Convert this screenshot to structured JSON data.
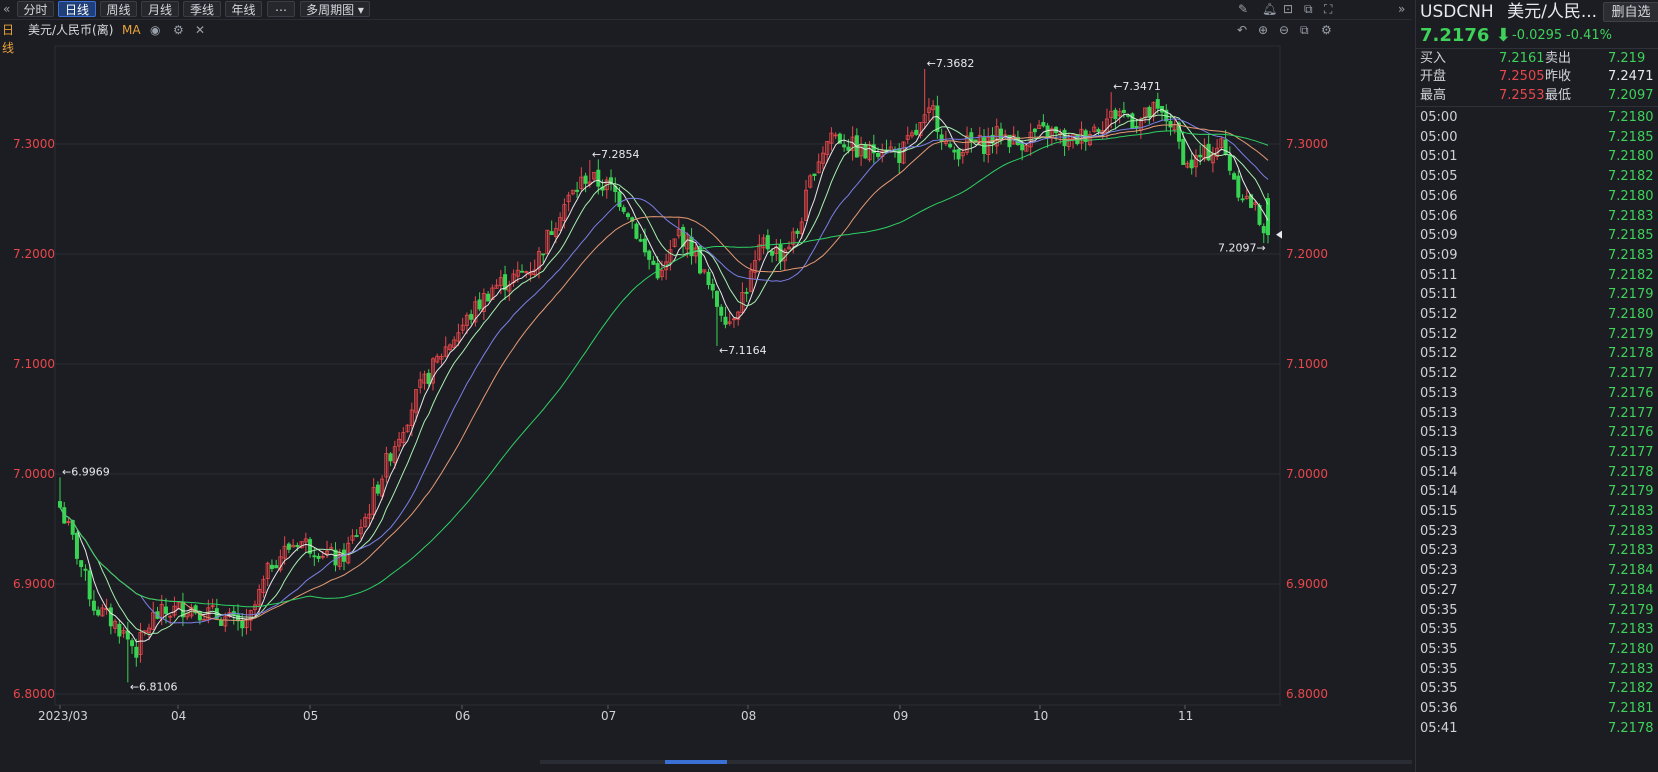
{
  "toolbar": {
    "back_icon": "double-chevron-left-icon",
    "tabs": [
      {
        "label": "分时",
        "active": false
      },
      {
        "label": "日线",
        "active": true
      },
      {
        "label": "周线",
        "active": false
      },
      {
        "label": "月线",
        "active": false
      },
      {
        "label": "季线",
        "active": false
      },
      {
        "label": "年线",
        "active": false
      },
      {
        "label": "⋯",
        "active": false
      },
      {
        "label": "多周期图 ▾",
        "active": false
      }
    ],
    "right_icons": [
      "pencil-icon",
      "bell-icon",
      "lock-icon",
      "camera-icon",
      "fullscreen-icon",
      "double-chevron-right-icon"
    ]
  },
  "legend": {
    "period": "日线",
    "instrument": "美元/人民币(离)",
    "indicator": "MA",
    "icons": [
      "eye-icon",
      "gear-icon",
      "close-icon"
    ],
    "right_icons": [
      "undo-icon",
      "zoom-in-icon",
      "zoom-out-icon",
      "compare-icon",
      "settings-icon"
    ]
  },
  "colors": {
    "up": "#e8474b",
    "down": "#39d353",
    "ma1": "#e9e9ea",
    "ma2": "#a8f0b0",
    "ma3": "#7b7fe6",
    "ma4": "#e59a74",
    "ma5": "#2ed163",
    "axis_label": "#e8474b",
    "grid": "#2b2d34"
  },
  "chart_data": {
    "type": "candlestick",
    "y_ticks": [
      "7.3000",
      "7.2000",
      "7.1000",
      "7.0000",
      "6.9000",
      "6.8000"
    ],
    "ylim": [
      6.8,
      7.38
    ],
    "x_ticks": [
      "2023/03",
      "04",
      "05",
      "06",
      "07",
      "08",
      "09",
      "10",
      "11"
    ],
    "annotations": [
      {
        "text": "←6.9969",
        "value": 6.9969
      },
      {
        "text": "←6.8106",
        "value": 6.8106
      },
      {
        "text": "←7.2854",
        "value": 7.2854
      },
      {
        "text": "←7.1164",
        "value": 7.1164
      },
      {
        "text": "←7.3682",
        "value": 7.3682
      },
      {
        "text": "←7.3471",
        "value": 7.3471
      },
      {
        "text": "7.2097→",
        "value": 7.2097
      }
    ],
    "close_anchors": [
      [
        0,
        6.97
      ],
      [
        3,
        6.94
      ],
      [
        8,
        6.88
      ],
      [
        14,
        6.86
      ],
      [
        18,
        6.84
      ],
      [
        22,
        6.87
      ],
      [
        30,
        6.88
      ],
      [
        38,
        6.87
      ],
      [
        44,
        6.86
      ],
      [
        50,
        6.92
      ],
      [
        56,
        6.94
      ],
      [
        62,
        6.93
      ],
      [
        66,
        6.92
      ],
      [
        72,
        6.96
      ],
      [
        78,
        7.02
      ],
      [
        84,
        7.07
      ],
      [
        90,
        7.11
      ],
      [
        96,
        7.14
      ],
      [
        102,
        7.17
      ],
      [
        108,
        7.18
      ],
      [
        112,
        7.19
      ],
      [
        118,
        7.24
      ],
      [
        124,
        7.27
      ],
      [
        130,
        7.26
      ],
      [
        134,
        7.24
      ],
      [
        138,
        7.2
      ],
      [
        142,
        7.18
      ],
      [
        146,
        7.22
      ],
      [
        150,
        7.2
      ],
      [
        154,
        7.16
      ],
      [
        158,
        7.14
      ],
      [
        162,
        7.17
      ],
      [
        166,
        7.21
      ],
      [
        170,
        7.2
      ],
      [
        174,
        7.22
      ],
      [
        178,
        7.28
      ],
      [
        182,
        7.31
      ],
      [
        186,
        7.3
      ],
      [
        190,
        7.29
      ],
      [
        194,
        7.3
      ],
      [
        198,
        7.29
      ],
      [
        202,
        7.31
      ],
      [
        206,
        7.33
      ],
      [
        210,
        7.29
      ],
      [
        214,
        7.3
      ],
      [
        218,
        7.3
      ],
      [
        222,
        7.31
      ],
      [
        226,
        7.3
      ],
      [
        230,
        7.31
      ],
      [
        234,
        7.31
      ],
      [
        238,
        7.3
      ],
      [
        242,
        7.31
      ],
      [
        246,
        7.32
      ],
      [
        250,
        7.33
      ],
      [
        254,
        7.32
      ],
      [
        258,
        7.33
      ],
      [
        262,
        7.32
      ],
      [
        266,
        7.28
      ],
      [
        270,
        7.29
      ],
      [
        274,
        7.3
      ],
      [
        278,
        7.26
      ],
      [
        282,
        7.24
      ],
      [
        285,
        7.2176
      ]
    ],
    "candle_count": 286
  },
  "quote": {
    "symbol": "USDCNH",
    "name": "美元/人民...",
    "remove_watch": "删自选",
    "price": "7.2176 ⬇",
    "change": "-0.0295",
    "change_pct": "-0.41%",
    "rows": [
      {
        "l1": "买入",
        "v1": "7.2161",
        "l2": "卖出",
        "v2": "7.219"
      },
      {
        "l1": "开盘",
        "v1": "7.2505",
        "l2": "昨收",
        "v2": "7.2471"
      },
      {
        "l1": "最高",
        "v1": "7.2553",
        "l2": "最低",
        "v2": "7.2097"
      }
    ]
  },
  "ticks": [
    {
      "time": "05:00",
      "price": "7.2180"
    },
    {
      "time": "05:00",
      "price": "7.2185"
    },
    {
      "time": "05:01",
      "price": "7.2180"
    },
    {
      "time": "05:05",
      "price": "7.2182"
    },
    {
      "time": "05:06",
      "price": "7.2180"
    },
    {
      "time": "05:06",
      "price": "7.2183"
    },
    {
      "time": "05:09",
      "price": "7.2185"
    },
    {
      "time": "05:09",
      "price": "7.2183"
    },
    {
      "time": "05:11",
      "price": "7.2182"
    },
    {
      "time": "05:11",
      "price": "7.2179"
    },
    {
      "time": "05:12",
      "price": "7.2180"
    },
    {
      "time": "05:12",
      "price": "7.2179"
    },
    {
      "time": "05:12",
      "price": "7.2178"
    },
    {
      "time": "05:12",
      "price": "7.2177"
    },
    {
      "time": "05:13",
      "price": "7.2176"
    },
    {
      "time": "05:13",
      "price": "7.2177"
    },
    {
      "time": "05:13",
      "price": "7.2176"
    },
    {
      "time": "05:13",
      "price": "7.2177"
    },
    {
      "time": "05:14",
      "price": "7.2178"
    },
    {
      "time": "05:14",
      "price": "7.2179"
    },
    {
      "time": "05:15",
      "price": "7.2183"
    },
    {
      "time": "05:23",
      "price": "7.2183"
    },
    {
      "time": "05:23",
      "price": "7.2183"
    },
    {
      "time": "05:23",
      "price": "7.2184"
    },
    {
      "time": "05:27",
      "price": "7.2184"
    },
    {
      "time": "05:35",
      "price": "7.2179"
    },
    {
      "time": "05:35",
      "price": "7.2183"
    },
    {
      "time": "05:35",
      "price": "7.2180"
    },
    {
      "time": "05:35",
      "price": "7.2183"
    },
    {
      "time": "05:35",
      "price": "7.2182"
    },
    {
      "time": "05:36",
      "price": "7.2181"
    },
    {
      "time": "05:41",
      "price": "7.2178"
    }
  ]
}
